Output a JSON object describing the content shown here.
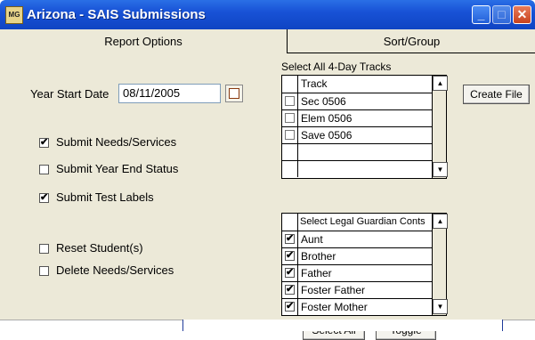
{
  "window": {
    "title": "Arizona - SAIS Submissions",
    "app_icon_text": "MG"
  },
  "tabs": [
    {
      "label": "Report Options"
    },
    {
      "label": "Sort/Group"
    }
  ],
  "year_start": {
    "label": "Year Start Date",
    "value": "08/11/2005"
  },
  "options": [
    {
      "label": "Submit Needs/Services",
      "checked": true
    },
    {
      "label": "Submit Year End Status",
      "checked": false
    },
    {
      "label": "Submit Test Labels",
      "checked": true
    },
    {
      "label": "Reset Student(s)",
      "checked": false
    },
    {
      "label": "Delete Needs/Services",
      "checked": false
    }
  ],
  "tracks": {
    "title": "Select All 4-Day Tracks",
    "header": "Track",
    "rows": [
      {
        "label": "Sec 0506",
        "checked": false
      },
      {
        "label": "Elem 0506",
        "checked": false
      },
      {
        "label": "Save 0506",
        "checked": false
      },
      {
        "label": "",
        "checked": false
      },
      {
        "label": "",
        "checked": false
      }
    ]
  },
  "guardians": {
    "header": "Select Legal Guardian Conts",
    "rows": [
      {
        "label": "Aunt",
        "checked": true
      },
      {
        "label": "Brother",
        "checked": true
      },
      {
        "label": "Father",
        "checked": true
      },
      {
        "label": "Foster Father",
        "checked": true
      },
      {
        "label": "Foster Mother",
        "checked": true
      }
    ]
  },
  "buttons": {
    "create_file": "Create File",
    "select_all": "Select All",
    "toggle": "Toggle"
  },
  "check_glyph": "✔"
}
